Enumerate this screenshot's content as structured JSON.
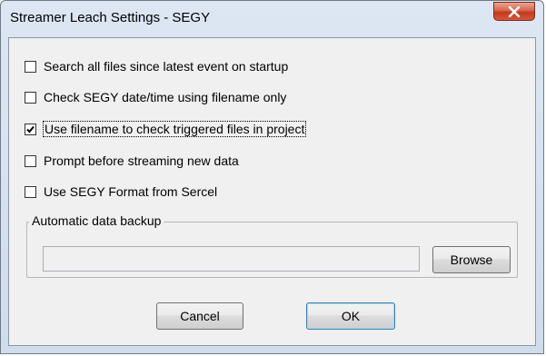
{
  "window": {
    "title": "Streamer Leach Settings - SEGY",
    "close_icon": "close-icon"
  },
  "options": [
    {
      "label": "Search all files since latest event on startup",
      "checked": false
    },
    {
      "label": "Check SEGY date/time using filename only",
      "checked": false
    },
    {
      "label": "Use filename to check triggered files in project",
      "checked": true
    },
    {
      "label": "Prompt before streaming new data",
      "checked": false
    },
    {
      "label": "Use SEGY Format from Sercel",
      "checked": false
    }
  ],
  "backup": {
    "group_label": "Automatic data backup",
    "path_value": "",
    "browse_label": "Browse"
  },
  "footer": {
    "cancel_label": "Cancel",
    "ok_label": "OK"
  },
  "colors": {
    "close_button": "#c3391b",
    "dialog_background": "#f0f0f0",
    "frame": "#cfdceb"
  }
}
